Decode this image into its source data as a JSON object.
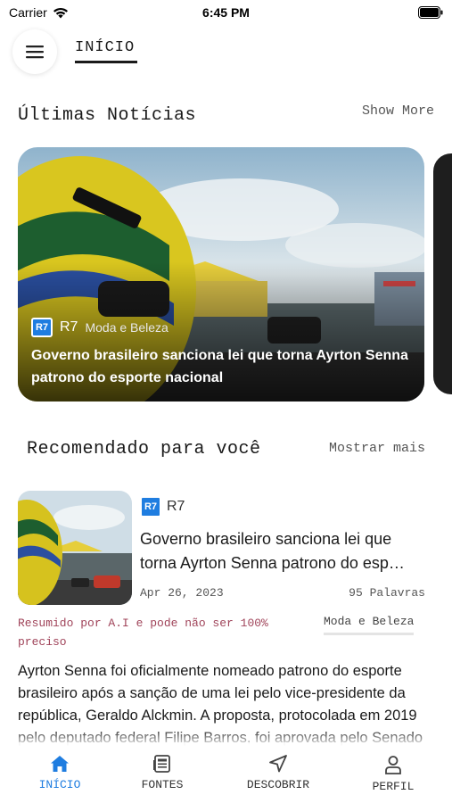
{
  "status_bar": {
    "carrier": "Carrier",
    "time": "6:45 PM"
  },
  "header": {
    "active_tab": "INÍCIO"
  },
  "latest": {
    "title": "Últimas Notícias",
    "more_label": "Show More",
    "featured": {
      "source": "R7",
      "source_logo_text": "R7",
      "category": "Moda e Beleza",
      "title": "Governo brasileiro sanciona lei que torna Ayrton Senna patrono do esporte nacional"
    }
  },
  "recommended": {
    "title": "Recomendado para você",
    "more_label": "Mostrar mais",
    "article": {
      "source": "R7",
      "source_logo_text": "R7",
      "title_line1": "Governo brasileiro sanciona lei que",
      "title_line2": "torna Ayrton Senna patrono do esp…",
      "date": "Apr 26, 2023",
      "words": "95 Palavras",
      "ai_note": "Resumido por A.I e pode não ser 100% preciso",
      "category": "Moda e Beleza",
      "summary": "Ayrton Senna foi oficialmente nomeado patrono do esporte brasileiro após a sanção de uma lei pelo vice-presidente da república, Geraldo Alckmin. A proposta, protocolada em 2019 pelo deputado federal Filipe Barros, foi aprovada pelo Senado"
    }
  },
  "bottom_nav": {
    "items": [
      {
        "label": "INÍCIO",
        "icon": "home-icon",
        "active": true
      },
      {
        "label": "FONTES",
        "icon": "newspaper-icon",
        "active": false
      },
      {
        "label": "DESCOBRIR",
        "icon": "navigation-arrow-icon",
        "active": false
      },
      {
        "label": "PERFIL",
        "icon": "person-icon",
        "active": false
      }
    ]
  },
  "colors": {
    "accent": "#1f7de0",
    "ai_note": "#a0445a",
    "text": "#1a1a1a"
  }
}
